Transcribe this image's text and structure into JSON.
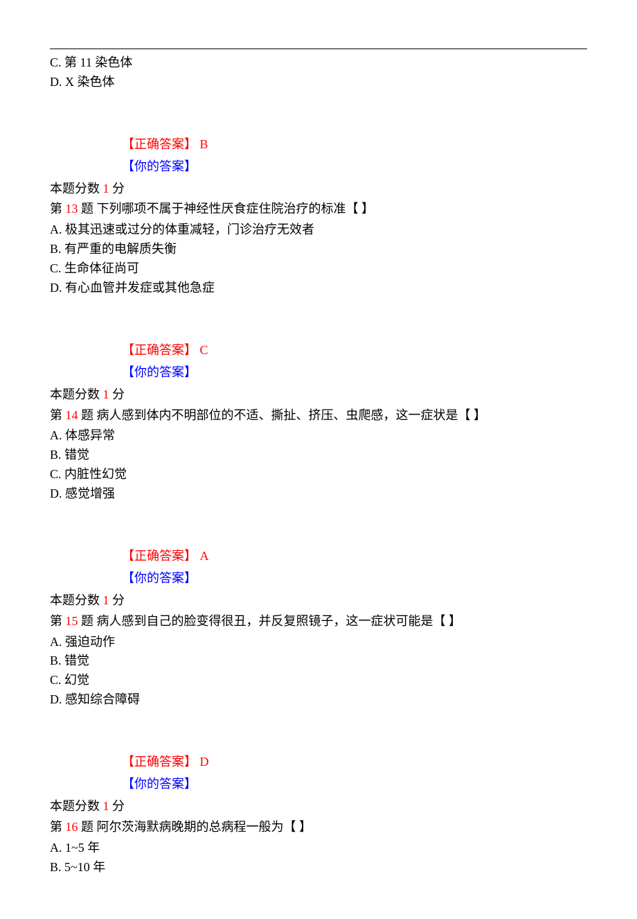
{
  "top_options": {
    "c": "C.  第 11 染色体",
    "d": "D.  X 染色体"
  },
  "groups": [
    {
      "correct_label": "【正确答案】 ",
      "correct_value": "B",
      "your_label": "【你的答案】",
      "score_prefix": "本题分数 ",
      "score_value": "1",
      "score_suffix": " 分",
      "q_prefix": "第 ",
      "q_num": "13",
      "q_suffix": " 题  下列哪项不属于神经性厌食症住院治疗的标准【 】",
      "opts": [
        "A.  极其迅速或过分的体重减轻，门诊治疗无效者",
        "B.  有严重的电解质失衡",
        "C.  生命体征尚可",
        "D.  有心血管并发症或其他急症"
      ]
    },
    {
      "correct_label": "【正确答案】 ",
      "correct_value": "C",
      "your_label": "【你的答案】",
      "score_prefix": "本题分数 ",
      "score_value": "1",
      "score_suffix": " 分",
      "q_prefix": "第 ",
      "q_num": "14",
      "q_suffix": " 题  病人感到体内不明部位的不适、撕扯、挤压、虫爬感，这一症状是【 】",
      "opts": [
        "A.  体感异常",
        "B.  错觉",
        "C.  内脏性幻觉",
        "D.  感觉增强"
      ]
    },
    {
      "correct_label": "【正确答案】 ",
      "correct_value": "A",
      "your_label": "【你的答案】",
      "score_prefix": "本题分数 ",
      "score_value": "1",
      "score_suffix": " 分",
      "q_prefix": "第 ",
      "q_num": "15",
      "q_suffix": " 题  病人感到自己的脸变得很丑，并反复照镜子，这一症状可能是【 】",
      "opts": [
        "A.  强迫动作",
        "B.  错觉",
        "C.  幻觉",
        "D.  感知综合障碍"
      ]
    },
    {
      "correct_label": "【正确答案】 ",
      "correct_value": "D",
      "your_label": "【你的答案】",
      "score_prefix": "本题分数 ",
      "score_value": "1",
      "score_suffix": " 分",
      "q_prefix": "第 ",
      "q_num": "16",
      "q_suffix": " 题  阿尔茨海默病晚期的总病程一般为【 】",
      "opts": [
        "A.  1~5 年",
        "B.  5~10 年"
      ]
    }
  ]
}
